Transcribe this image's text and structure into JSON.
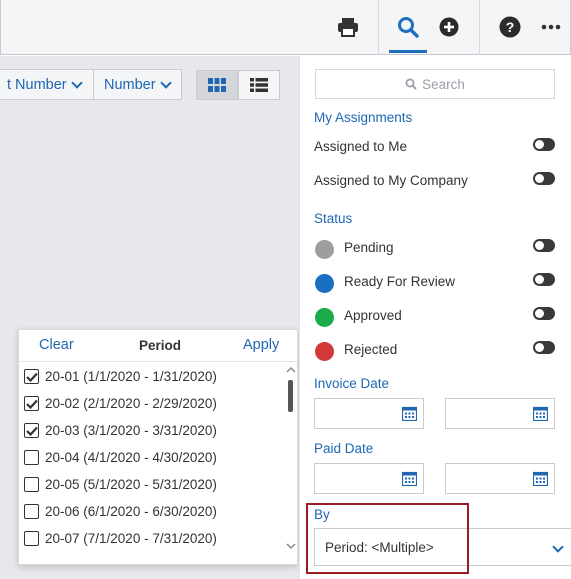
{
  "toolbar": {
    "icons": [
      "print-icon",
      "search-icon",
      "add-icon",
      "help-icon",
      "more-icon"
    ],
    "accent": "#1f6fc0"
  },
  "grid_controls": {
    "sort1_label": "t Number",
    "sort2_label": "Number"
  },
  "period_popup": {
    "clear_label": "Clear",
    "title": "Period",
    "apply_label": "Apply",
    "items": [
      {
        "label": "20-01 (1/1/2020 - 1/31/2020)",
        "checked": true
      },
      {
        "label": "20-02 (2/1/2020 - 2/29/2020)",
        "checked": true
      },
      {
        "label": "20-03 (3/1/2020 - 3/31/2020)",
        "checked": true
      },
      {
        "label": "20-04 (4/1/2020 - 4/30/2020)",
        "checked": false
      },
      {
        "label": "20-05 (5/1/2020 - 5/31/2020)",
        "checked": false
      },
      {
        "label": "20-06 (6/1/2020 - 6/30/2020)",
        "checked": false
      },
      {
        "label": "20-07 (7/1/2020 - 7/31/2020)",
        "checked": false
      }
    ]
  },
  "filters": {
    "search_placeholder": "Search",
    "my_assignments": {
      "title": "My Assignments",
      "items": [
        "Assigned to Me",
        "Assigned to My Company"
      ]
    },
    "status": {
      "title": "Status",
      "items": [
        {
          "label": "Pending",
          "color": "#9e9e9e"
        },
        {
          "label": "Ready For Review",
          "color": "#1a6fc2"
        },
        {
          "label": "Approved",
          "color": "#1bab4b"
        },
        {
          "label": "Rejected",
          "color": "#d23a3a"
        }
      ]
    },
    "invoice_date_title": "Invoice Date",
    "paid_date_title": "Paid Date",
    "by_title": "By",
    "by_value": "Period: <Multiple>"
  }
}
